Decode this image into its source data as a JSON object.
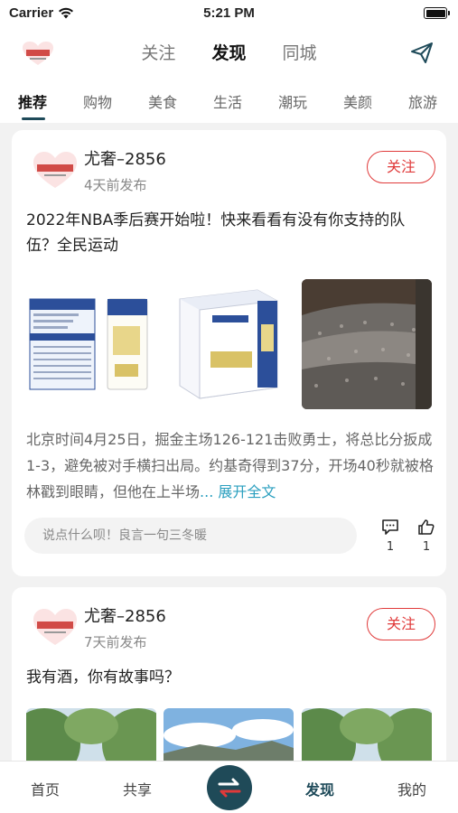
{
  "status_bar": {
    "carrier": "Carrier",
    "time": "5:21 PM"
  },
  "top_nav": {
    "tabs": [
      "关注",
      "发现",
      "同城"
    ],
    "active_tab": "发现"
  },
  "categories": [
    "推荐",
    "购物",
    "美食",
    "生活",
    "潮玩",
    "美颜",
    "旅游"
  ],
  "posts": [
    {
      "username": "尤奢–2856",
      "time": "4天前发布",
      "follow_label": "关注",
      "title": "2022年NBA季后赛开始啦！快来看看有没有你支持的队伍？全民运动",
      "excerpt": "北京时间4月25日，掘金主场126-121击败勇士，将总比分扳成1-3，避免被对手横扫出局。约基奇得到37分，开场40秒就被格林戳到眼睛，但他在上半场",
      "more_label": "... 展开全文",
      "comment_placeholder": "说点什么呗！良言一句三冬暖",
      "comment_count": "1",
      "like_count": "1",
      "images": [
        "nutrition-label-milk-carton",
        "milk-gift-box",
        "crowd-photo"
      ]
    },
    {
      "username": "尤奢–2856",
      "time": "7天前发布",
      "follow_label": "关注",
      "title": "我有酒，你有故事吗？",
      "images": [
        "tree-road-photo",
        "sky-landscape-photo",
        "tree-road-photo"
      ]
    }
  ],
  "tab_bar": {
    "items": [
      "首页",
      "共享",
      "发现",
      "我的"
    ],
    "active": "发现"
  },
  "colors": {
    "accent": "#1e4a59",
    "follow_red": "#e03a3a",
    "link": "#2a9fbf"
  }
}
